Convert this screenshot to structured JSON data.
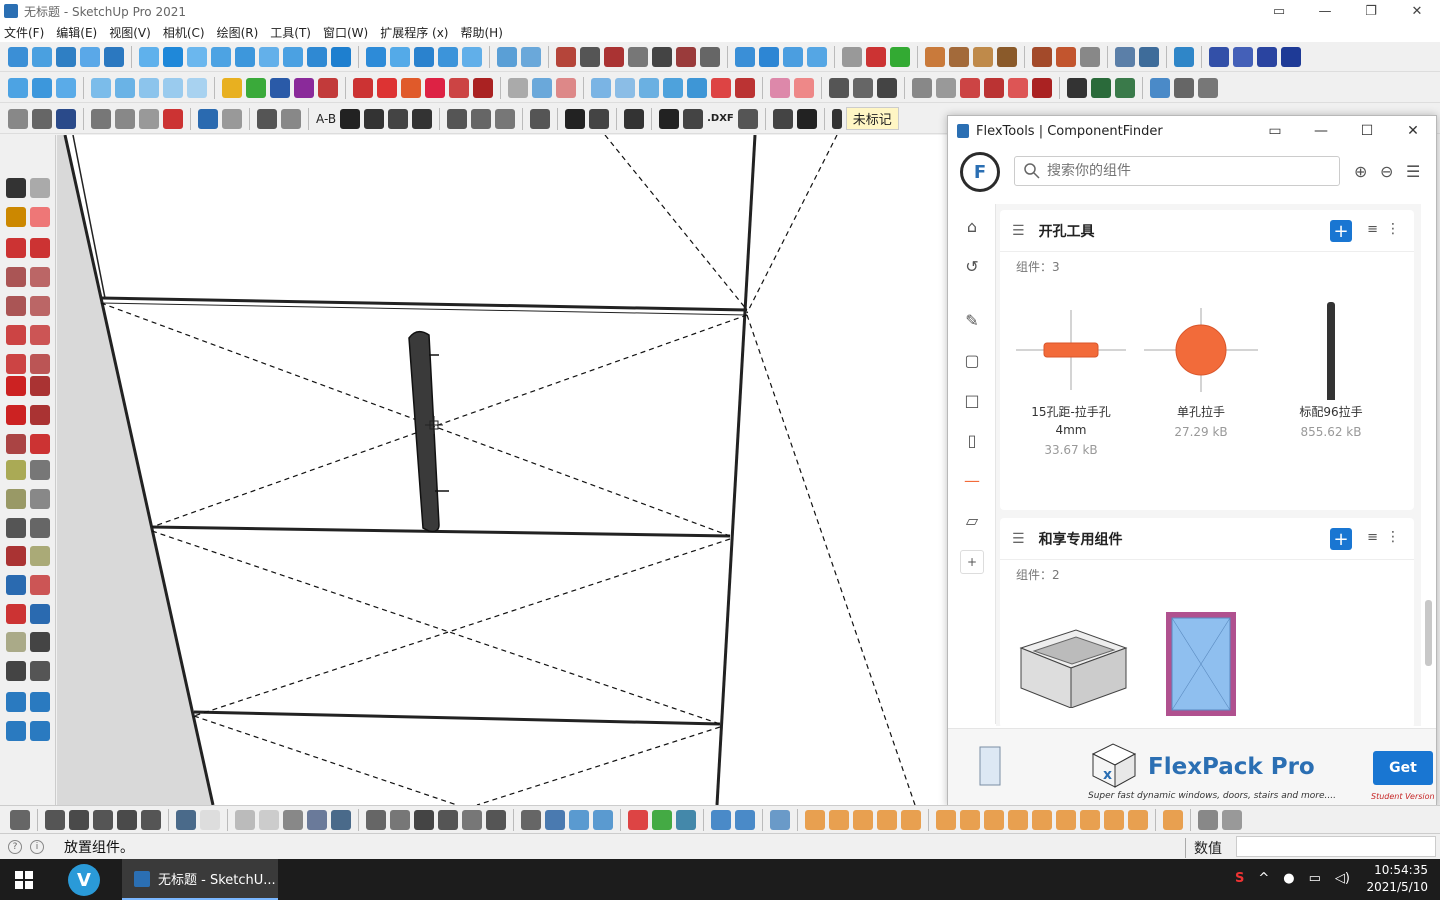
{
  "window": {
    "title": "无标题 - SketchUp Pro 2021",
    "controls": [
      "▭",
      "—",
      "❐",
      "✕"
    ]
  },
  "menu": [
    "文件(F)",
    "编辑(E)",
    "视图(V)",
    "相机(C)",
    "绘图(R)",
    "工具(T)",
    "窗口(W)",
    "扩展程序 (x)",
    "帮助(H)"
  ],
  "toolbar": {
    "tag_label": "未标记",
    "ab_label": "A-B",
    "dxf_label": ".DXF"
  },
  "flextools": {
    "title": "FlexTools | ComponentFinder",
    "logo_letter": "F",
    "search_placeholder": "搜索你的组件",
    "groups": [
      {
        "name": "开孔工具",
        "count": "组件：3",
        "items": [
          {
            "name": "15孔距-拉手孔",
            "name2": "4mm",
            "size": "33.67 kB"
          },
          {
            "name": "单孔拉手",
            "name2": "",
            "size": "27.29 kB"
          },
          {
            "name": "标配96拉手",
            "name2": "",
            "size": "855.62 kB"
          }
        ]
      },
      {
        "name": "和享专用组件",
        "count": "组件：2"
      }
    ],
    "banner": {
      "title": "FlexPack Pro",
      "subtitle": "Super fast dynamic windows, doors, stairs and more....",
      "button": "Get",
      "tag": "Student Version"
    }
  },
  "status": {
    "message": "放置组件。",
    "value_label": "数值",
    "value": ""
  },
  "taskbar": {
    "app_label": "无标题 - SketchU...",
    "time": "10:54:35",
    "date": "2021/5/10"
  },
  "colors": {
    "accent": "#1976d2",
    "orange": "#f26b3a"
  }
}
